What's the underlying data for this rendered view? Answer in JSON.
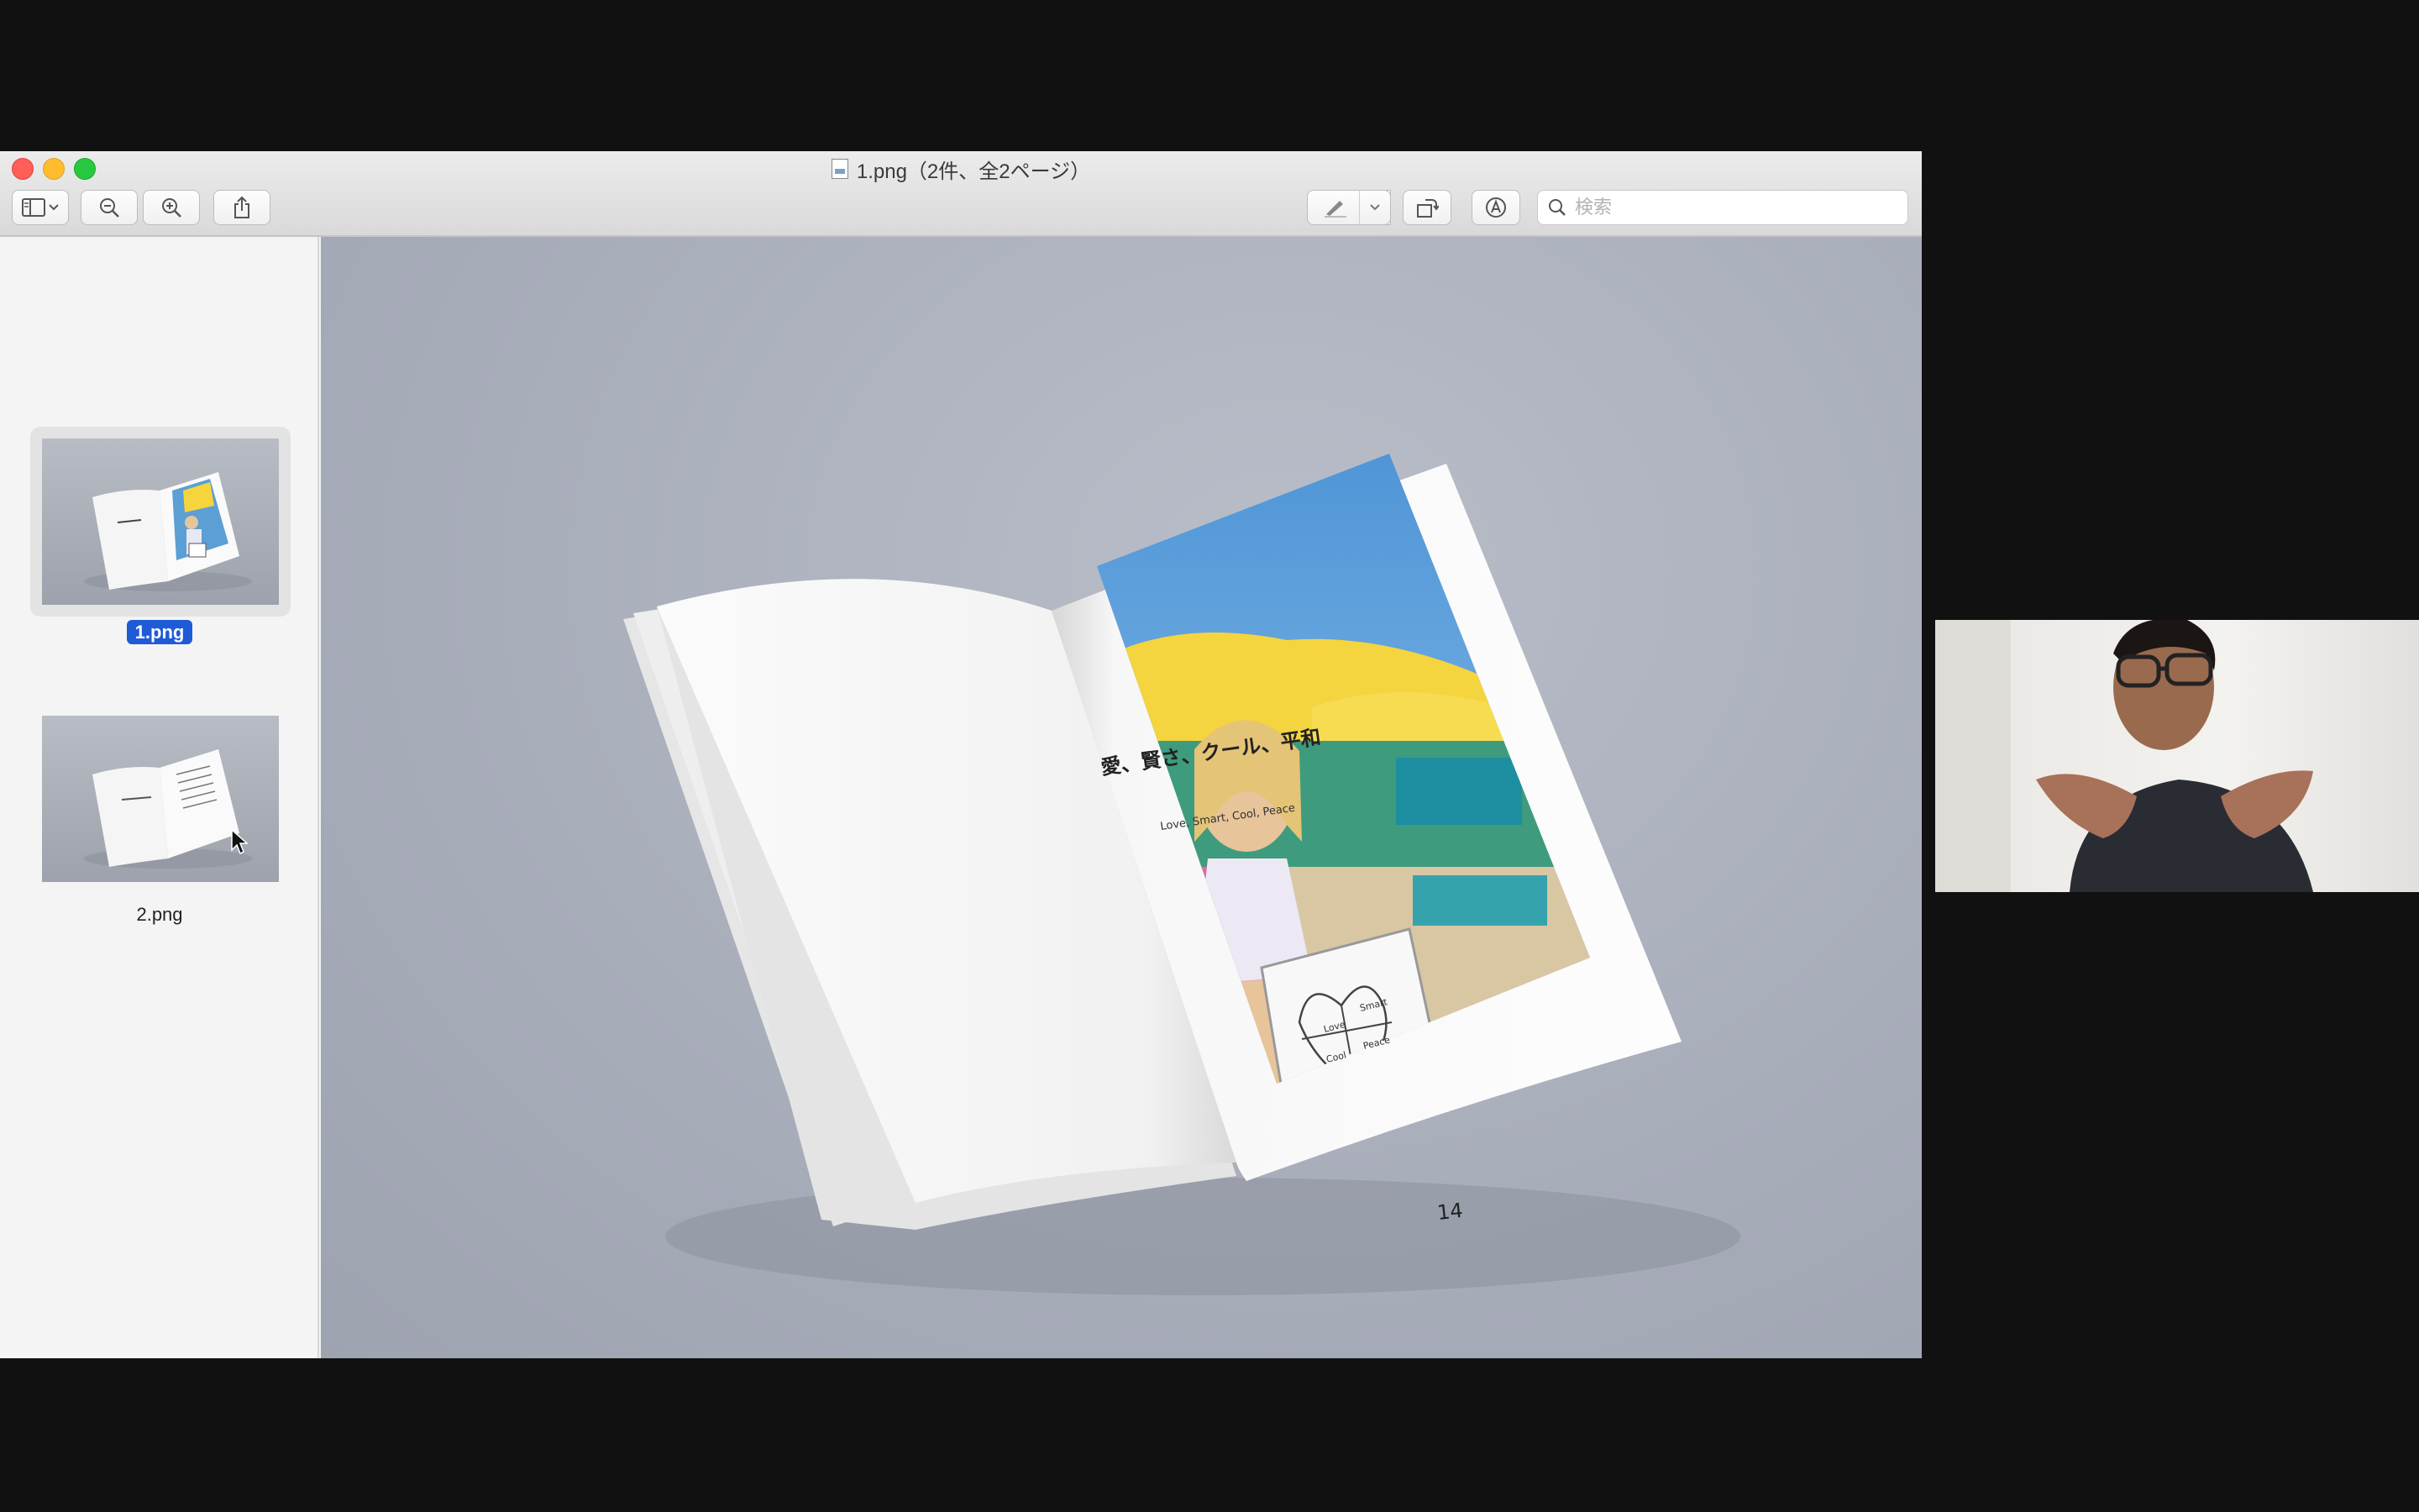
{
  "window": {
    "title": "1.png（2件、全2ページ）"
  },
  "toolbar": {
    "search_placeholder": "検索",
    "icons": [
      "sidebar-icon",
      "chevron-down-icon",
      "zoom-out-icon",
      "zoom-in-icon",
      "share-icon",
      "pen-icon",
      "chevron-down-icon",
      "rotate-icon",
      "markup-icon",
      "search-icon"
    ]
  },
  "sidebar": {
    "items": [
      {
        "label": "1.png",
        "selected": true
      },
      {
        "label": "2.png",
        "selected": false
      }
    ]
  },
  "document": {
    "heading_jp": "愛、賢さ、クール、平和",
    "subheading_en": "Love, Smart, Cool, Peace",
    "page_number": "14",
    "sign_words": [
      "Love",
      "Smart",
      "Cool",
      "Peace"
    ]
  },
  "colors": {
    "selection": "#1f5bd6",
    "close": "#ff5f57",
    "minimize": "#ffbd2e",
    "maximize": "#28c940"
  }
}
